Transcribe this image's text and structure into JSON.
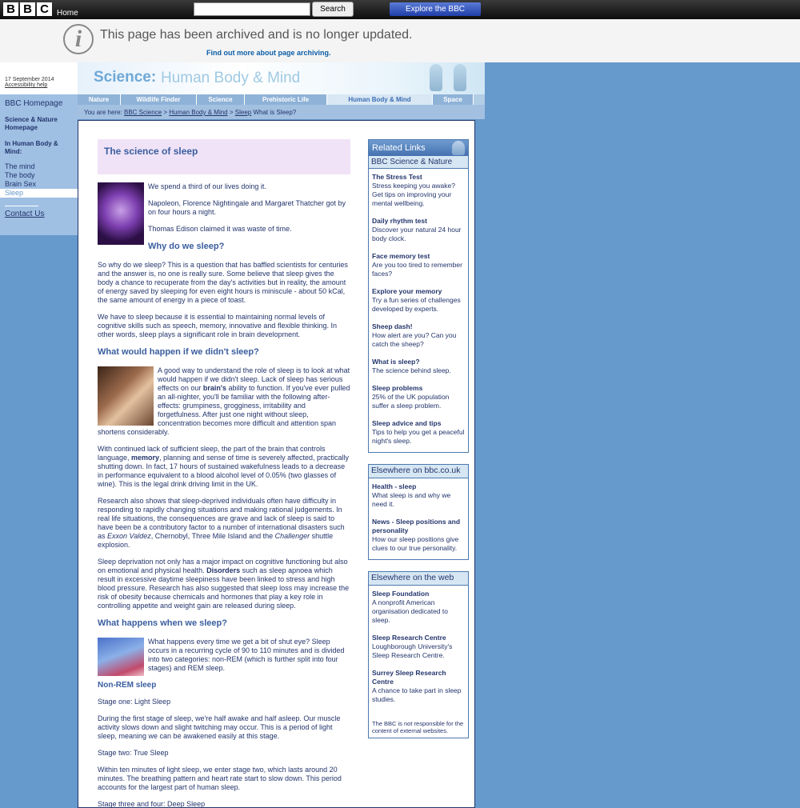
{
  "topbar": {
    "logo_letters": [
      "B",
      "B",
      "C"
    ],
    "home_label": "Home",
    "search_value": "",
    "search_button": "Search",
    "explore_label": "Explore the BBC"
  },
  "archive": {
    "title": "This page has been archived and is no longer updated.",
    "link": "Find out more about page archiving."
  },
  "leftnav": {
    "date": "17 September 2014",
    "accessibility": "Accessibility help",
    "bbc_home": "BBC Homepage",
    "sn_home": "Science & Nature Homepage",
    "in_section": "In Human Body & Mind:",
    "items": [
      "The mind",
      "The body",
      "Brain Sex",
      "Sleep"
    ],
    "contact": "Contact Us"
  },
  "header": {
    "science": "Science:",
    "section": "Human Body & Mind"
  },
  "tabs": [
    {
      "label": "Nature",
      "w": 54
    },
    {
      "label": "Wildlife Finder",
      "w": 95
    },
    {
      "label": "Science",
      "w": 60
    },
    {
      "label": "Prehistoric Life",
      "w": 103
    },
    {
      "label": "Human Body & Mind",
      "w": 132
    },
    {
      "label": "Space",
      "w": 51
    }
  ],
  "breadcrumb": {
    "prefix": "You are here:",
    "crumbs": [
      "BBC Science",
      "Human Body & Mind",
      "Sleep"
    ],
    "current": "What is Sleep?"
  },
  "article": {
    "title": "The science of sleep",
    "intro": [
      "We spend a third of our lives doing it.",
      "Napoleon, Florence Nightingale and Margaret Thatcher got by on four hours a night.",
      "Thomas Edison claimed it was waste of time."
    ],
    "h_why": "Why do we sleep?",
    "why_p1": "So why do we sleep? This is a question that has baffled scientists for centuries and the answer is, no one is really sure. Some believe that sleep gives the body a chance to recuperate from the day's activities but in reality, the amount of energy saved by sleeping for even eight hours is miniscule - about 50 kCal, the same amount of energy in a piece of toast.",
    "why_p2": "We have to sleep because it is essential to maintaining normal levels of cognitive skills such as speech, memory, innovative and flexible thinking. In other words, sleep plays a significant role in brain development.",
    "h_didnt": "What would happen if we didn't sleep?",
    "didnt_p1_a": "A good way to understand the role of sleep is to look at what would happen if we didn't sleep. Lack of sleep has serious effects on our ",
    "didnt_p1_b": "brain's",
    "didnt_p1_c": " ability to function. If you've ever pulled an all-nighter, you'll be familiar with the following after-effects: grumpiness, grogginess, irritability and forgetfulness. After just one night without sleep, concentration becomes more difficult and attention span shortens considerably.",
    "didnt_p2_a": "With continued lack of sufficient sleep, the part of the brain that controls language, ",
    "didnt_p2_b": "memory",
    "didnt_p2_c": ", planning and sense of time is severely affected, practically shutting down. In fact, 17 hours of sustained wakefulness leads to a decrease in performance equivalent to a blood alcohol level of 0.05% (two glasses of wine). This is the legal drink driving limit in the UK.",
    "didnt_p3_a": "Research also shows that sleep-deprived individuals often have difficulty in responding to rapidly changing situations and making rational judgements. In real life situations, the consequences are grave and lack of sleep is said to have been be a contributory factor to a number of international disasters such as ",
    "didnt_p3_b": "Exxon Valdez",
    "didnt_p3_c": ", Chernobyl, Three Mile Island and the ",
    "didnt_p3_d": "Challenger",
    "didnt_p3_e": " shuttle explosion.",
    "didnt_p4_a": "Sleep deprivation not only has a major impact on cognitive functioning but also on emotional and physical health. ",
    "didnt_p4_b": "Disorders",
    "didnt_p4_c": " such as sleep apnoea which result in excessive daytime sleepiness have been linked to stress and high blood pressure. Research has also suggested that sleep loss may increase the risk of obesity because chemicals and hormones that play a key role in controlling appetite and weight gain are released during sleep.",
    "h_when": "What happens when we sleep?",
    "when_p1": "What happens every time we get a bit of shut eye? Sleep occurs in a recurring cycle of 90 to 110 minutes and is divided into two categories: non-REM (which is further split into four stages) and REM sleep.",
    "h_nonrem": "Non-REM sleep",
    "stage1": "Stage one: Light Sleep",
    "stage1_p": "During the first stage of sleep, we're half awake and half asleep. Our muscle activity slows down and slight twitching may occur. This is a period of light sleep, meaning we can be awakened easily at this stage.",
    "stage2": "Stage two: True Sleep",
    "stage2_p": "Within ten minutes of light sleep, we enter stage two, which lasts around 20 minutes. The breathing pattern and heart rate start to slow down. This period accounts for the largest part of human sleep.",
    "stage3": "Stage three and four: Deep Sleep"
  },
  "sidebar": {
    "related_head": "Related Links",
    "related_sub": "BBC Science & Nature",
    "related": [
      {
        "title": "The Stress Test",
        "desc": "Stress keeping you awake? Get tips on improving your mental wellbeing."
      },
      {
        "title": "Daily rhythm test",
        "desc": "Discover your natural 24 hour body clock."
      },
      {
        "title": "Face memory test",
        "desc": "Are you too tired to remember faces?"
      },
      {
        "title": "Explore your memory",
        "desc": "Try a fun series of challenges developed by experts."
      },
      {
        "title": "Sheep dash!",
        "desc": "How alert are you? Can you catch the sheep?"
      },
      {
        "title": "What is sleep?",
        "desc": "The science behind sleep."
      },
      {
        "title": "Sleep problems",
        "desc": "25% of the UK population suffer a sleep problem."
      },
      {
        "title": "Sleep advice and tips",
        "desc": "Tips to help you get a peaceful night's sleep."
      }
    ],
    "elsewhere_bbc_head": "Elsewhere on bbc.co.uk",
    "elsewhere_bbc": [
      {
        "title": "Health - sleep",
        "desc": "What sleep is and why we need it."
      },
      {
        "title": "News - Sleep positions and personality",
        "desc": "How our sleep positions give clues to our true personality."
      }
    ],
    "elsewhere_web_head": "Elsewhere on the web",
    "elsewhere_web": [
      {
        "title": "Sleep Foundation",
        "desc": "A nonprofit American organisation dedicated to sleep."
      },
      {
        "title": "Sleep Research Centre",
        "desc": "Loughborough University's Sleep Research Centre."
      },
      {
        "title": "Surrey Sleep Research Centre",
        "desc": "A chance to take part in sleep studies."
      }
    ],
    "disclaimer": "The BBC is not responsible for the content of external websites."
  }
}
